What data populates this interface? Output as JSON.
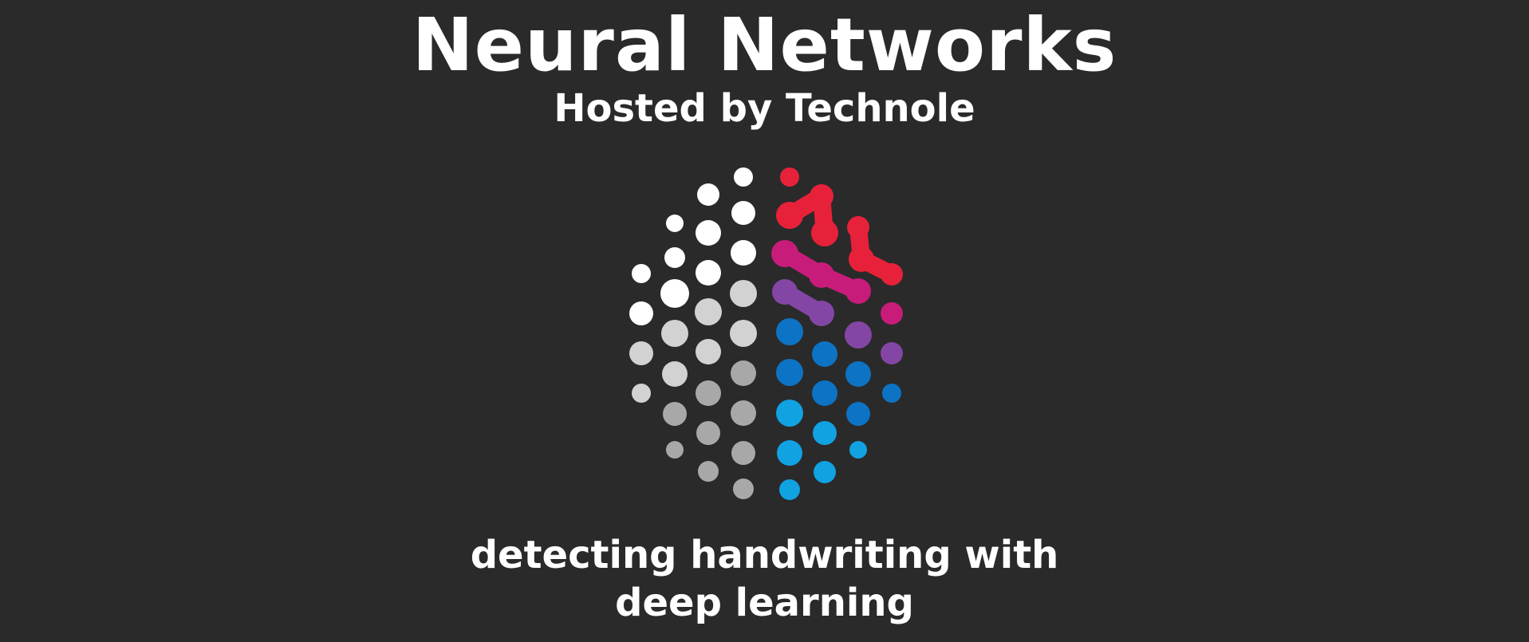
{
  "header": {
    "title": "Neural Networks",
    "subtitle": "Hosted by Technole"
  },
  "logo": {
    "icon": "neural-brain-dots-icon",
    "colors": {
      "white": "#ffffff",
      "light_gray": "#d2d2d2",
      "gray": "#a8a8a8",
      "red": "#e8213a",
      "magenta": "#c81c7a",
      "purple": "#8446a4",
      "blue": "#0d73c4",
      "light_blue": "#11a2e2"
    }
  },
  "footer": {
    "tagline_line1": "detecting handwriting with",
    "tagline_line2": "deep learning"
  },
  "theme": {
    "background": "#2a2a2a",
    "text": "#ffffff"
  }
}
